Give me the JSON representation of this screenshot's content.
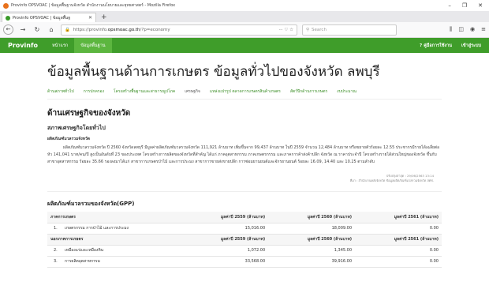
{
  "browser": {
    "window_title": "Provinfo OPSVOAC | ข้อมูลพื้นฐานจังหวัด สำนักงานนโยบายและยุทธศาสตร์ - Mozilla Firefox",
    "tab_title": "Provinfo OPSVOAC | ข้อมูลพื้นฐ",
    "url_prefix": "https://provinfo.",
    "url_domain": "opsmoac.go.th",
    "url_suffix": "/?p=economy",
    "search_placeholder": "Search",
    "url_actions": "··· ♡ ☆"
  },
  "sitenav": {
    "brand": "Provinfo",
    "items": [
      "หน้าแรก",
      "ข้อมูลพื้นฐาน"
    ],
    "right": [
      "? คู่มือการใช้งาน",
      "เข้าสู่ระบบ"
    ]
  },
  "page": {
    "title": "ข้อมูลพื้นฐานด้านการเกษตร ข้อมูลทั่วไปของจังหวัด ลพบุรี",
    "subnav": [
      "ด้านสภาพทั่วไป",
      "การปกครอง",
      "โครงสร้างพื้นฐานและสาธารณูปโภค",
      "เศรษฐกิจ",
      "แหล่งแปรรูป ตลาดการเกษตรสินค้าเกษตร",
      "สัตว์ปีกด้านการเกษตร",
      "งบประมาณ"
    ],
    "section_title": "ด้านเศรษฐกิจของจังหวัด",
    "subsection_title": "สภาพเศรษฐกิจโดยทั่วไป",
    "gpp_heading": "ผลิตภัณฑ์มวลรวมจังหวัด",
    "paragraph": "ผลิตภัณฑ์มวลรวมจังหวัด ปี 2560 จังหวัดลพบุรี มีมูลค่าผลิตภัณฑ์มวลรวมจังหวัด 111,921 ล้านบาท เพิ่มขึ้นจาก 99,437 ล้านบาท ในปี 2559 จำนวน 12,484 ล้านบาท หรือขยายตัวร้อยละ 12.55 ประชากรมีรายได้เฉลี่ยต่อหัว 141,041 บาท/คน/ปี สูงเป็นอันดับที่ 23 ของประเทศ โครงสร้างการผลิตของจังหวัดที่สำคัญ ได้แก่ ภาคอุตสาหกรรม ภาคเกษตรกรรม และภาคการค้าส่งค้าปลีก จังหวัด ณ ราคาประจำปี โครงสร้างรายได้ส่วนใหญ่ของจังหวัด ขึ้นกับสาขาอุตสาหกรรม ร้อยละ 35.66 รองลงมาได้แก่ สาขาการเกษตรป่าไม้ และการประมง สาขาการขายส่งขายปลีก การซ่อมยานยนต์และจักรยานยนต์ ร้อยละ 16.09, 14.40 และ 10.25 ตามลำดับ",
    "meta_date": "ปรับปรุงล่าสุด : 29/06/2563 13:14",
    "meta_source": "ที่มา : สำนักงานคลังจังหวัด ข้อมูลผลิตภัณฑ์มวลรวมจังหวัด สศช."
  },
  "gpp": {
    "title": "ผลิตภัณฑ์มวลรวมของจังหวัด(GPP)",
    "headers": [
      "ภาคการเกษตร",
      "มูลค่าปี 2559 (ล้านบาท)",
      "มูลค่าปี 2560 (ล้านบาท)",
      "มูลค่าปี 2561 (ล้านบาท)"
    ],
    "rows": [
      {
        "idx": "1.",
        "name": "เกษตรกรรม การป่าไม้ และการประมง",
        "v1": "15,016.00",
        "v2": "18,009.00",
        "v3": "0.00"
      }
    ],
    "group2": "นอกภาคการเกษตร",
    "rows2": [
      {
        "idx": "2.",
        "name": "เหมืองแร่และเหมืองหิน",
        "v1": "1,072.00",
        "v2": "1,345.00",
        "v3": "0.00"
      },
      {
        "idx": "3.",
        "name": "การผลิตอุตสาหกรรม",
        "v1": "33,568.00",
        "v2": "39,916.00",
        "v3": "0.00"
      }
    ]
  }
}
